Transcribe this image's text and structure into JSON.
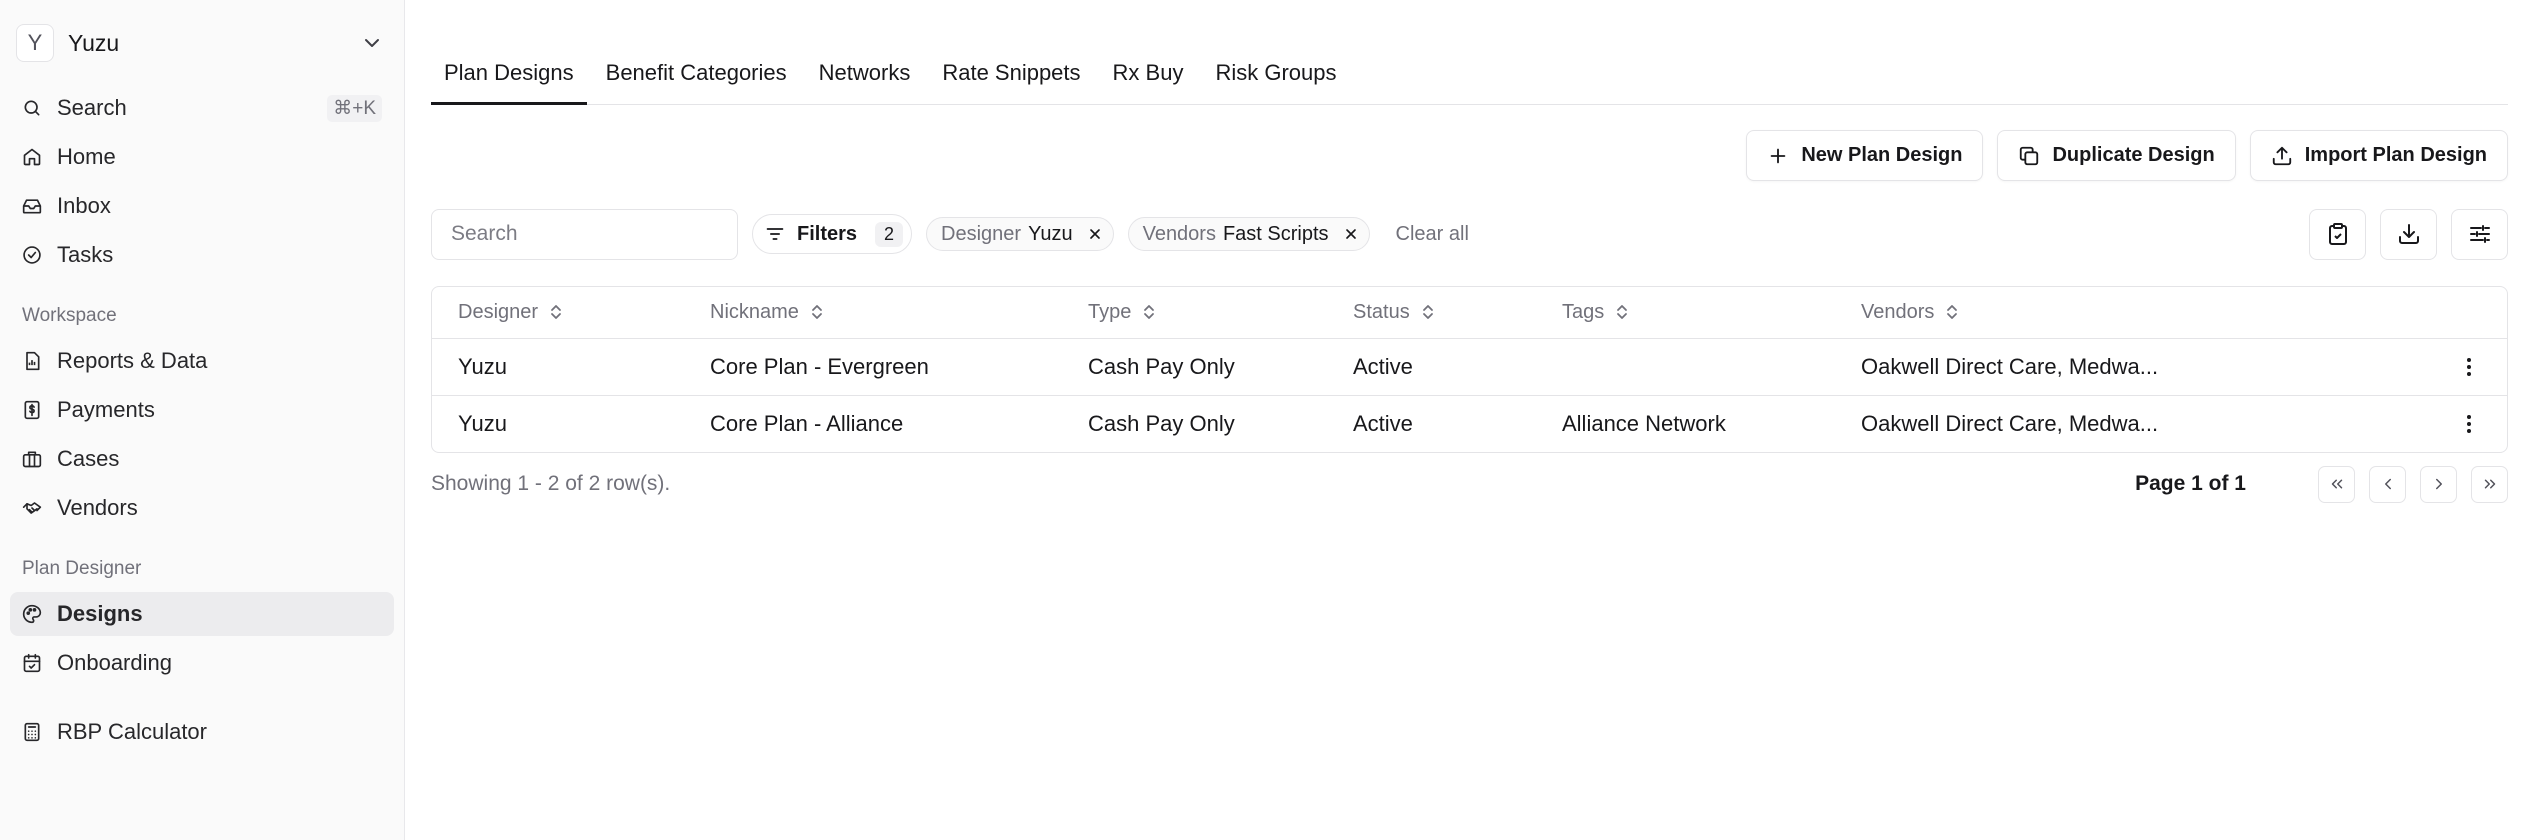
{
  "org": {
    "initial": "Y",
    "name": "Yuzu"
  },
  "nav_top": [
    {
      "label": "Search",
      "shortcut": "⌘+K",
      "icon": "search-icon"
    },
    {
      "label": "Home",
      "icon": "home-icon"
    },
    {
      "label": "Inbox",
      "icon": "inbox-icon"
    },
    {
      "label": "Tasks",
      "icon": "check-circle-icon"
    }
  ],
  "workspace": {
    "title": "Workspace",
    "items": [
      {
        "label": "Reports & Data",
        "icon": "report-icon"
      },
      {
        "label": "Payments",
        "icon": "dollar-icon"
      },
      {
        "label": "Cases",
        "icon": "briefcase-icon"
      },
      {
        "label": "Vendors",
        "icon": "handshake-icon"
      }
    ]
  },
  "plan_designer": {
    "title": "Plan Designer",
    "items": [
      {
        "label": "Designs",
        "icon": "palette-icon",
        "active": true
      },
      {
        "label": "Onboarding",
        "icon": "calendar-check-icon"
      }
    ]
  },
  "calculator": {
    "label": "RBP Calculator",
    "icon": "calculator-icon"
  },
  "tabs": [
    "Plan Designs",
    "Benefit Categories",
    "Networks",
    "Rate Snippets",
    "Rx Buy",
    "Risk Groups"
  ],
  "actions": {
    "new": "New Plan Design",
    "duplicate": "Duplicate Design",
    "import": "Import Plan Design"
  },
  "toolbar": {
    "search_placeholder": "Search",
    "filters_label": "Filters",
    "filters_count": "2",
    "chips": [
      {
        "key": "Designer",
        "value": "Yuzu"
      },
      {
        "key": "Vendors",
        "value": "Fast Scripts"
      }
    ],
    "clear_all": "Clear all"
  },
  "table": {
    "columns": [
      "Designer",
      "Nickname",
      "Type",
      "Status",
      "Tags",
      "Vendors"
    ],
    "rows": [
      [
        "Yuzu",
        "Core Plan - Evergreen",
        "Cash Pay Only",
        "Active",
        "",
        "Oakwell Direct Care, Medwa..."
      ],
      [
        "Yuzu",
        "Core Plan - Alliance",
        "Cash Pay Only",
        "Active",
        "Alliance Network",
        "Oakwell Direct Care, Medwa..."
      ]
    ]
  },
  "footer": {
    "showing": "Showing 1 - 2 of 2 row(s).",
    "page_info": "Page 1 of 1"
  }
}
